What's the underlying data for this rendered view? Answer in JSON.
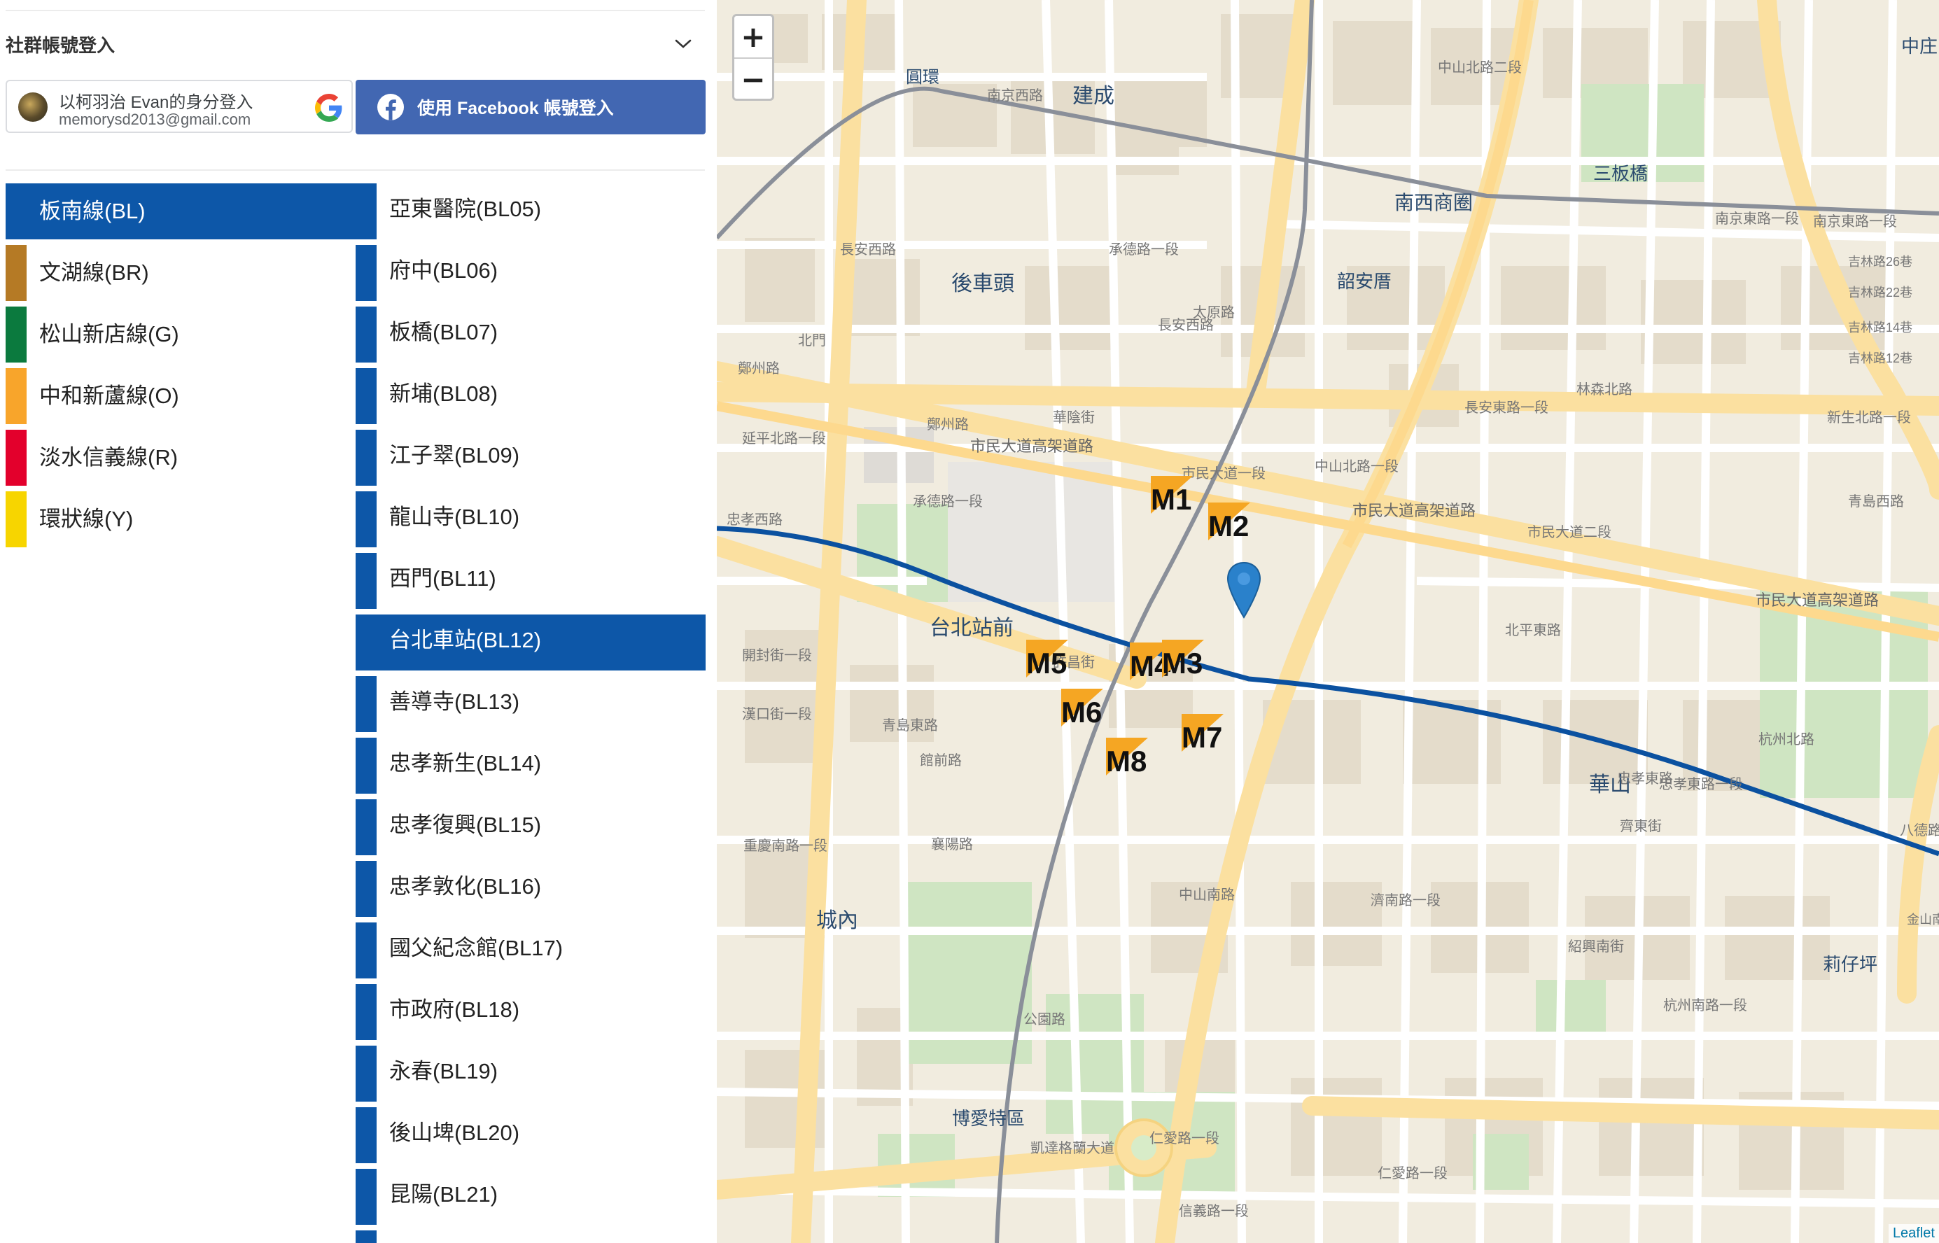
{
  "social_login": {
    "title": "社群帳號登入",
    "google_line1": "以柯羽治 Evan的身分登入",
    "google_email": "memorysd2013@gmail.com",
    "facebook_label": "使用 Facebook 帳號登入"
  },
  "lines": [
    {
      "label": "板南線(BL)",
      "color": "#0d57a8",
      "active": true
    },
    {
      "label": "文湖線(BR)",
      "color": "#b57a25"
    },
    {
      "label": "松山新店線(G)",
      "color": "#0b7a3e"
    },
    {
      "label": "中和新蘆線(O)",
      "color": "#f8a52b"
    },
    {
      "label": "淡水信義線(R)",
      "color": "#e3002c"
    },
    {
      "label": "環狀線(Y)",
      "color": "#f7d500"
    }
  ],
  "stations": [
    {
      "label": "亞東醫院(BL05)"
    },
    {
      "label": "府中(BL06)"
    },
    {
      "label": "板橋(BL07)"
    },
    {
      "label": "新埔(BL08)"
    },
    {
      "label": "江子翠(BL09)"
    },
    {
      "label": "龍山寺(BL10)"
    },
    {
      "label": "西門(BL11)"
    },
    {
      "label": "台北車站(BL12)",
      "active": true
    },
    {
      "label": "善導寺(BL13)"
    },
    {
      "label": "忠孝新生(BL14)"
    },
    {
      "label": "忠孝復興(BL15)"
    },
    {
      "label": "忠孝敦化(BL16)"
    },
    {
      "label": "國父紀念館(BL17)"
    },
    {
      "label": "市政府(BL18)"
    },
    {
      "label": "永春(BL19)"
    },
    {
      "label": "後山埤(BL20)"
    },
    {
      "label": "昆陽(BL21)"
    }
  ],
  "map": {
    "zoom_in": "+",
    "zoom_out": "−",
    "attribution": "Leaflet",
    "exits": [
      "M1",
      "M2",
      "M3",
      "M4",
      "M5",
      "M6",
      "M7",
      "M8"
    ],
    "place_labels": {
      "yuanhuan": "圓環",
      "jiancheng": "建成",
      "houchetou": "後車頭",
      "shaoxingshi": "韶安厝",
      "nanxi": "南西商圈",
      "sanban": "三板橋",
      "taipeizhanqian": "台北站前",
      "huashan": "華山",
      "chengnei": "城內",
      "boaite": "博愛特區",
      "liziping": "莉仔坪",
      "zhongzhuang": "中庄"
    },
    "road_labels": {
      "nanjing_w": "南京西路",
      "nanjing_e1": "南京東路一段",
      "nanjing_e1b": "南京東路一段",
      "changan_w": "長安西路",
      "changan_e1": "長安東路一段",
      "civic_viaduct": "市民大道高架道路",
      "civic_viaduct2": "市民大道高架道路",
      "civic_viaduct3": "市民大道高架道路",
      "civic_1": "市民大道一段",
      "civic_2": "市民大道二段",
      "zhengzhou": "鄭州路",
      "beiping_e": "北平東路",
      "zhongxiao_e": "忠孝東路",
      "zhongshan_s": "中山南路",
      "zhongshan_n1": "中山北路一段",
      "chongqing_s": "重慶南路一段",
      "zhongxiao_w": "忠孝西路",
      "xiangyang": "襄陽路",
      "jinan": "濟南路一段",
      "renai1": "仁愛路一段",
      "renai1b": "仁愛路一段",
      "xinyi": "信義路一段",
      "qingdao_e": "青島東路",
      "kaifeng": "開封街一段",
      "hankou": "漢口街一段",
      "chengde": "承德路一段",
      "linsen_n": "林森北路",
      "xinsheng_n": "新生北路一段",
      "hangzhou_n": "杭州北路",
      "hangzhou_s": "杭州南路一段",
      "shaoxing_s": "紹興南街",
      "ketagalan": "凱達格蘭大道",
      "gongyuan": "公園路",
      "bade": "八德路",
      "changan_w2": "長安西路",
      "huashan_l": "忠孝東路一段",
      "zhengzhou2": "鄭州路",
      "taiyuan": "太原路",
      "chengde2": "承德路一段",
      "yanping": "延平北路一段",
      "jilin": "吉林路26巷",
      "jilin2": "吉林路22巷",
      "jilin3": "吉林路14巷",
      "jilin4": "吉林路12巷",
      "beimen": "北門",
      "jiaxing": "華陰街",
      "zhongshan2": "中山北路二段",
      "xuchang": "許昌街",
      "guanqian": "館前路",
      "nanhai": "青島西路",
      "qidong": "齊東街",
      "jinshan": "金山南路"
    }
  }
}
